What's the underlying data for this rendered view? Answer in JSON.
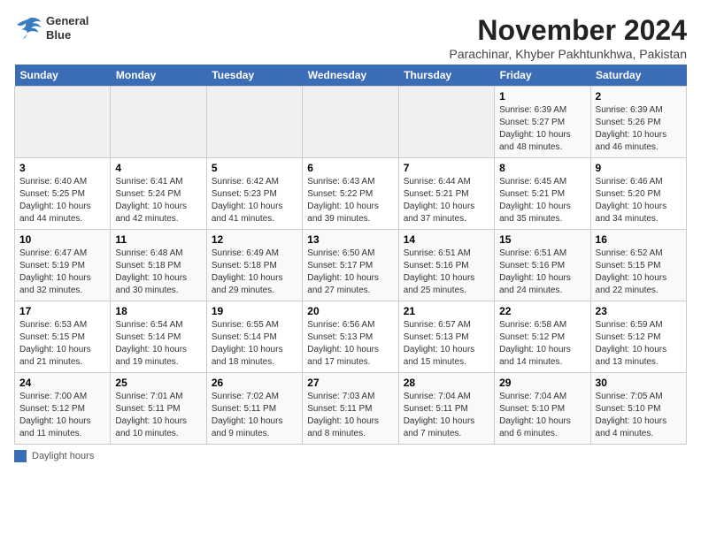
{
  "header": {
    "logo_line1": "General",
    "logo_line2": "Blue",
    "month": "November 2024",
    "location": "Parachinar, Khyber Pakhtunkhwa, Pakistan"
  },
  "weekdays": [
    "Sunday",
    "Monday",
    "Tuesday",
    "Wednesday",
    "Thursday",
    "Friday",
    "Saturday"
  ],
  "legend_label": "Daylight hours",
  "weeks": [
    [
      {
        "day": "",
        "info": ""
      },
      {
        "day": "",
        "info": ""
      },
      {
        "day": "",
        "info": ""
      },
      {
        "day": "",
        "info": ""
      },
      {
        "day": "",
        "info": ""
      },
      {
        "day": "1",
        "info": "Sunrise: 6:39 AM\nSunset: 5:27 PM\nDaylight: 10 hours and 48 minutes."
      },
      {
        "day": "2",
        "info": "Sunrise: 6:39 AM\nSunset: 5:26 PM\nDaylight: 10 hours and 46 minutes."
      }
    ],
    [
      {
        "day": "3",
        "info": "Sunrise: 6:40 AM\nSunset: 5:25 PM\nDaylight: 10 hours and 44 minutes."
      },
      {
        "day": "4",
        "info": "Sunrise: 6:41 AM\nSunset: 5:24 PM\nDaylight: 10 hours and 42 minutes."
      },
      {
        "day": "5",
        "info": "Sunrise: 6:42 AM\nSunset: 5:23 PM\nDaylight: 10 hours and 41 minutes."
      },
      {
        "day": "6",
        "info": "Sunrise: 6:43 AM\nSunset: 5:22 PM\nDaylight: 10 hours and 39 minutes."
      },
      {
        "day": "7",
        "info": "Sunrise: 6:44 AM\nSunset: 5:21 PM\nDaylight: 10 hours and 37 minutes."
      },
      {
        "day": "8",
        "info": "Sunrise: 6:45 AM\nSunset: 5:21 PM\nDaylight: 10 hours and 35 minutes."
      },
      {
        "day": "9",
        "info": "Sunrise: 6:46 AM\nSunset: 5:20 PM\nDaylight: 10 hours and 34 minutes."
      }
    ],
    [
      {
        "day": "10",
        "info": "Sunrise: 6:47 AM\nSunset: 5:19 PM\nDaylight: 10 hours and 32 minutes."
      },
      {
        "day": "11",
        "info": "Sunrise: 6:48 AM\nSunset: 5:18 PM\nDaylight: 10 hours and 30 minutes."
      },
      {
        "day": "12",
        "info": "Sunrise: 6:49 AM\nSunset: 5:18 PM\nDaylight: 10 hours and 29 minutes."
      },
      {
        "day": "13",
        "info": "Sunrise: 6:50 AM\nSunset: 5:17 PM\nDaylight: 10 hours and 27 minutes."
      },
      {
        "day": "14",
        "info": "Sunrise: 6:51 AM\nSunset: 5:16 PM\nDaylight: 10 hours and 25 minutes."
      },
      {
        "day": "15",
        "info": "Sunrise: 6:51 AM\nSunset: 5:16 PM\nDaylight: 10 hours and 24 minutes."
      },
      {
        "day": "16",
        "info": "Sunrise: 6:52 AM\nSunset: 5:15 PM\nDaylight: 10 hours and 22 minutes."
      }
    ],
    [
      {
        "day": "17",
        "info": "Sunrise: 6:53 AM\nSunset: 5:15 PM\nDaylight: 10 hours and 21 minutes."
      },
      {
        "day": "18",
        "info": "Sunrise: 6:54 AM\nSunset: 5:14 PM\nDaylight: 10 hours and 19 minutes."
      },
      {
        "day": "19",
        "info": "Sunrise: 6:55 AM\nSunset: 5:14 PM\nDaylight: 10 hours and 18 minutes."
      },
      {
        "day": "20",
        "info": "Sunrise: 6:56 AM\nSunset: 5:13 PM\nDaylight: 10 hours and 17 minutes."
      },
      {
        "day": "21",
        "info": "Sunrise: 6:57 AM\nSunset: 5:13 PM\nDaylight: 10 hours and 15 minutes."
      },
      {
        "day": "22",
        "info": "Sunrise: 6:58 AM\nSunset: 5:12 PM\nDaylight: 10 hours and 14 minutes."
      },
      {
        "day": "23",
        "info": "Sunrise: 6:59 AM\nSunset: 5:12 PM\nDaylight: 10 hours and 13 minutes."
      }
    ],
    [
      {
        "day": "24",
        "info": "Sunrise: 7:00 AM\nSunset: 5:12 PM\nDaylight: 10 hours and 11 minutes."
      },
      {
        "day": "25",
        "info": "Sunrise: 7:01 AM\nSunset: 5:11 PM\nDaylight: 10 hours and 10 minutes."
      },
      {
        "day": "26",
        "info": "Sunrise: 7:02 AM\nSunset: 5:11 PM\nDaylight: 10 hours and 9 minutes."
      },
      {
        "day": "27",
        "info": "Sunrise: 7:03 AM\nSunset: 5:11 PM\nDaylight: 10 hours and 8 minutes."
      },
      {
        "day": "28",
        "info": "Sunrise: 7:04 AM\nSunset: 5:11 PM\nDaylight: 10 hours and 7 minutes."
      },
      {
        "day": "29",
        "info": "Sunrise: 7:04 AM\nSunset: 5:10 PM\nDaylight: 10 hours and 6 minutes."
      },
      {
        "day": "30",
        "info": "Sunrise: 7:05 AM\nSunset: 5:10 PM\nDaylight: 10 hours and 4 minutes."
      }
    ]
  ]
}
